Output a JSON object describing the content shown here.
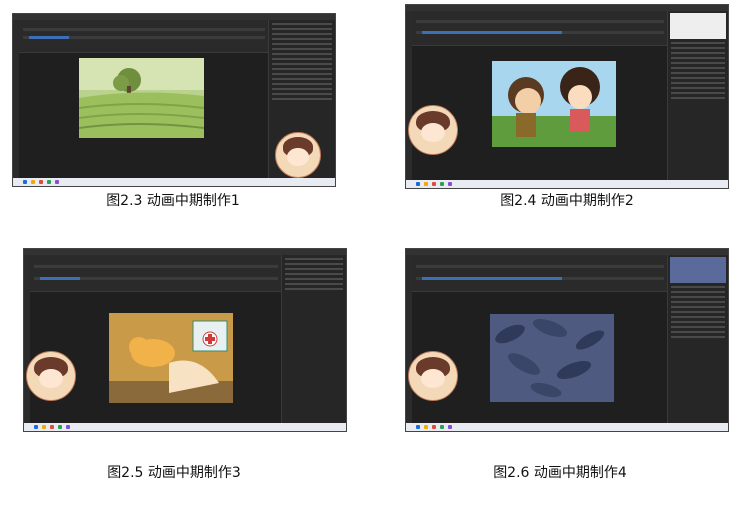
{
  "figures": [
    {
      "id": "fig-2-3",
      "caption": "图2.3 动画中期制作1",
      "scene": "rice-terrace-landscape"
    },
    {
      "id": "fig-2-4",
      "caption": "图2.4 动画中期制作2",
      "scene": "two-characters-talking"
    },
    {
      "id": "fig-2-5",
      "caption": "图2.5 动画中期制作3",
      "scene": "duck-and-first-aid-kit"
    },
    {
      "id": "fig-2-6",
      "caption": "图2.6 动画中期制作4",
      "scene": "dark-leaves-background"
    }
  ],
  "colors": {
    "app_bg": "#1f1f1f",
    "panel": "#262626",
    "timeline_accent": "#3d6fb6",
    "taskbar": "#e8ecf2"
  }
}
